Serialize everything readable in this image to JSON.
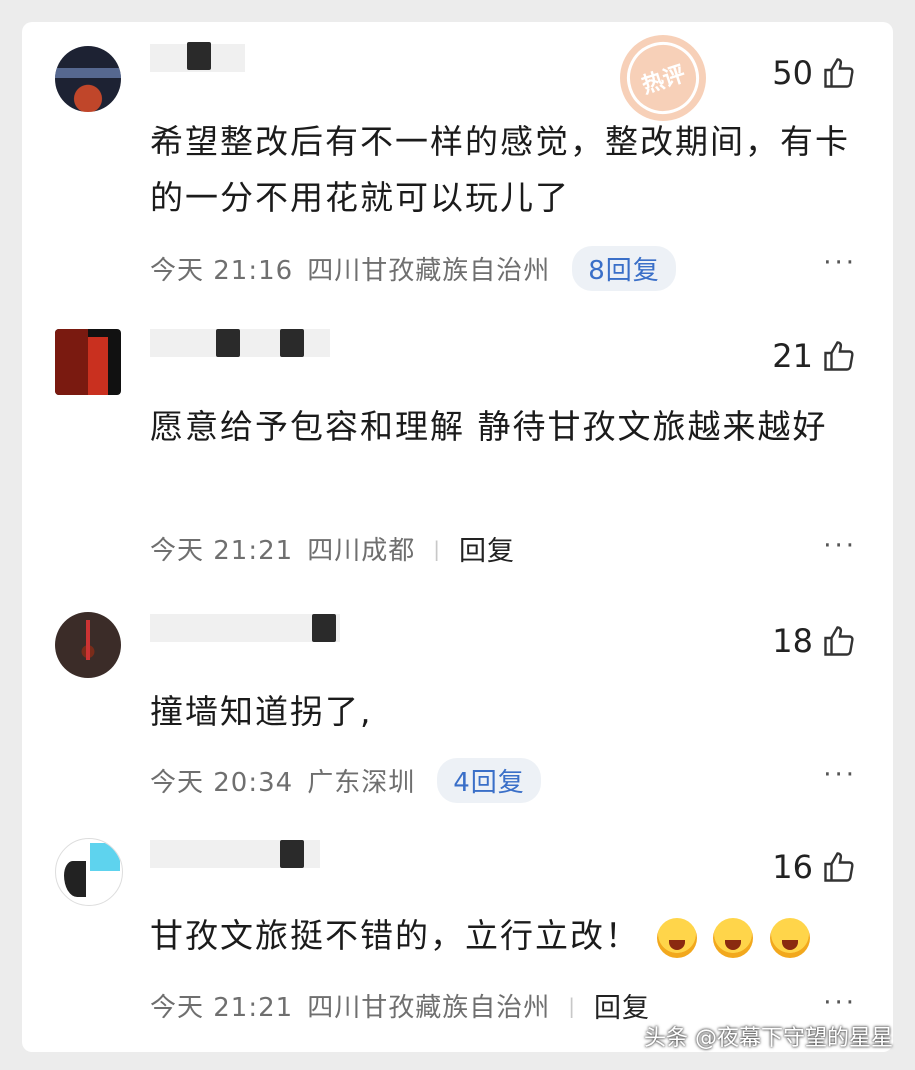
{
  "comments": [
    {
      "likes": "50",
      "badge": "热评",
      "text": "希望整改后有不一样的感觉，整改期间，有卡的一分不用花就可以玩儿了",
      "time": "今天 21:16",
      "location": "四川甘孜藏族自治州",
      "reply": "8回复"
    },
    {
      "likes": "21",
      "text": "愿意给予包容和理解 静待甘孜文旅越来越好",
      "time": "今天 21:21",
      "location": "四川成都",
      "reply": "回复"
    },
    {
      "likes": "18",
      "text": "撞墙知道拐了,",
      "time": "今天 20:34",
      "location": "广东深圳",
      "reply": "4回复"
    },
    {
      "likes": "16",
      "text": "甘孜文旅挺不错的，立行立改！",
      "time": "今天 21:21",
      "location": "四川甘孜藏族自治州",
      "reply": "回复"
    }
  ],
  "more_label": "···",
  "watermark": "头条 @夜幕下守望的星星",
  "colors": {
    "hot_badge": "#f7d0b8",
    "reply_pill_text": "#3a6fc8"
  }
}
